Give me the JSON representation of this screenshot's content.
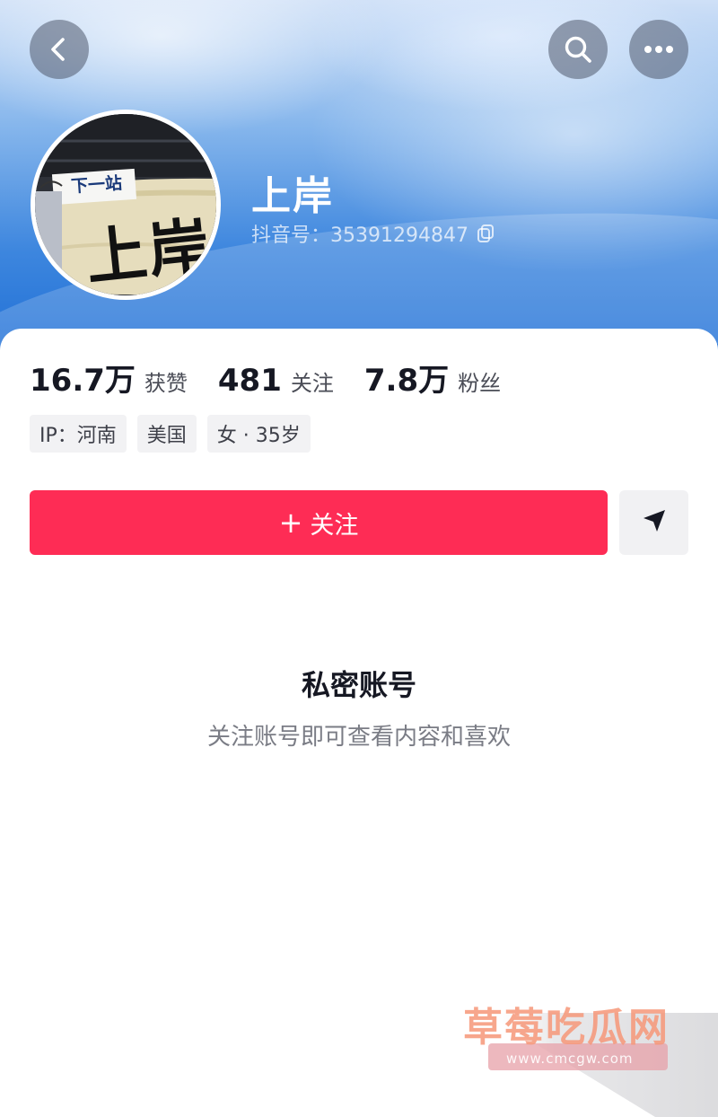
{
  "profile": {
    "nickname": "上岸",
    "id_label": "抖音号：35391294847",
    "avatar_text_top": "下一站",
    "avatar_text_main": "上岸"
  },
  "stats": [
    {
      "value": "16.7万",
      "label": "获赞"
    },
    {
      "value": "481",
      "label": "关注"
    },
    {
      "value": "7.8万",
      "label": "粉丝"
    }
  ],
  "tags": [
    "IP：河南",
    "美国",
    "女 · 35岁"
  ],
  "actions": {
    "follow_plus": "+",
    "follow_label": "关注"
  },
  "private": {
    "title": "私密账号",
    "subtitle": "关注账号即可查看内容和喜欢"
  },
  "watermark": {
    "name": "草莓吃瓜网",
    "url": "www.cmcgw.com"
  },
  "colors": {
    "accent": "#fe2c55",
    "banner_blue": "#1f6fd6"
  },
  "icons": {
    "back": "chevron-left-icon",
    "search": "search-icon",
    "more": "more-dots-icon",
    "copy": "copy-icon",
    "send": "send-icon"
  }
}
